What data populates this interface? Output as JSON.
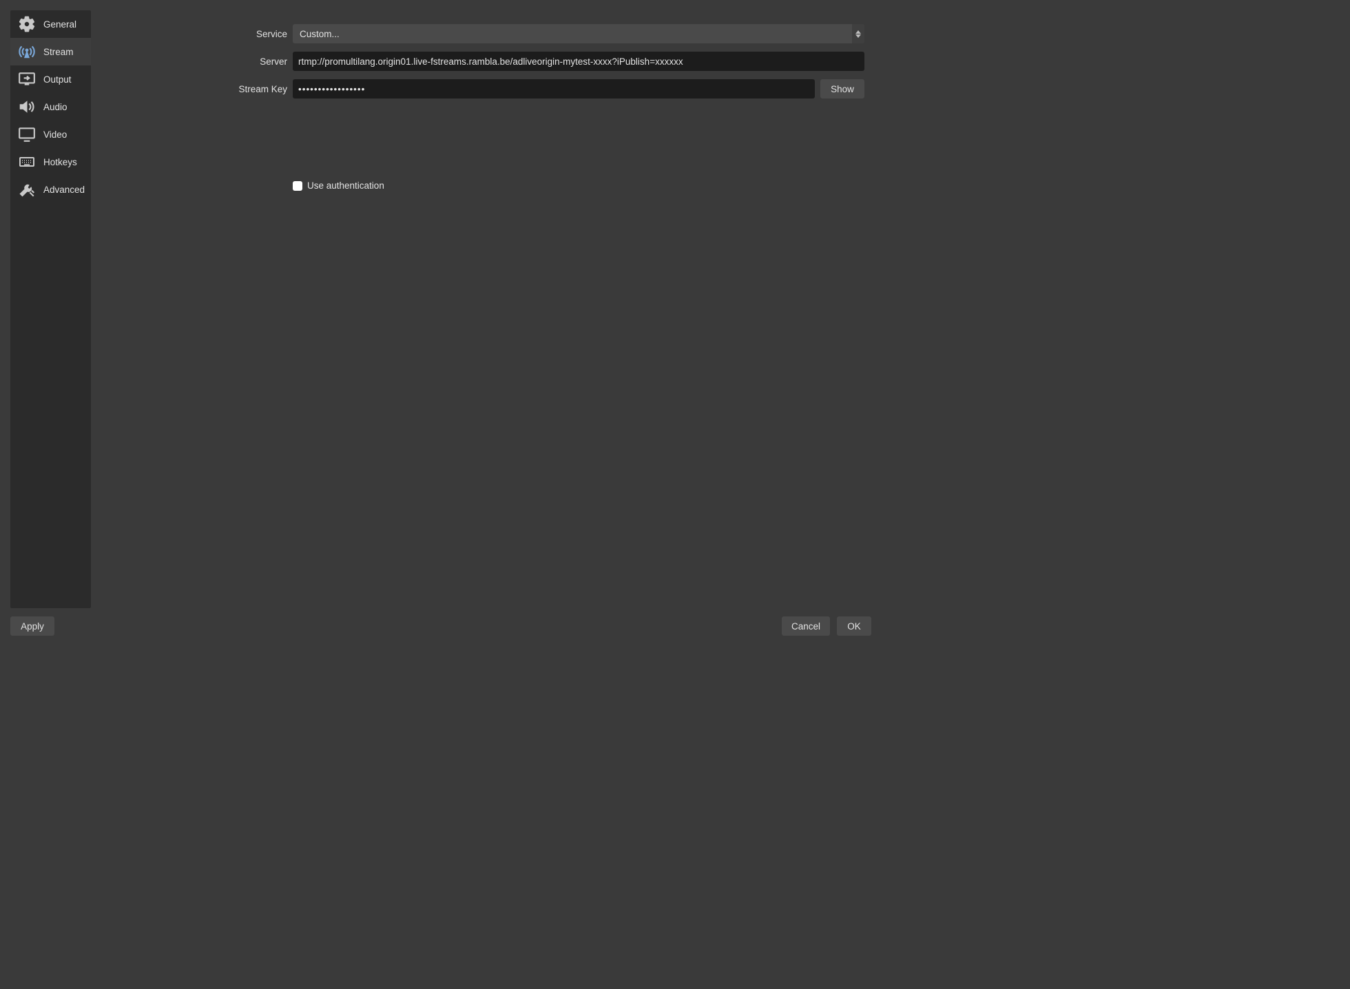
{
  "sidebar": {
    "items": [
      {
        "label": "General"
      },
      {
        "label": "Stream"
      },
      {
        "label": "Output"
      },
      {
        "label": "Audio"
      },
      {
        "label": "Video"
      },
      {
        "label": "Hotkeys"
      },
      {
        "label": "Advanced"
      }
    ],
    "active_index": 1
  },
  "form": {
    "service_label": "Service",
    "service_value": "Custom...",
    "server_label": "Server",
    "server_value": "rtmp://promultilang.origin01.live-fstreams.rambla.be/adliveorigin-mytest-xxxx?iPublish=xxxxxx",
    "streamkey_label": "Stream Key",
    "streamkey_value": "•••••••••••••••••",
    "show_button": "Show",
    "use_auth_label": "Use authentication",
    "use_auth_checked": false
  },
  "footer": {
    "apply": "Apply",
    "cancel": "Cancel",
    "ok": "OK"
  }
}
